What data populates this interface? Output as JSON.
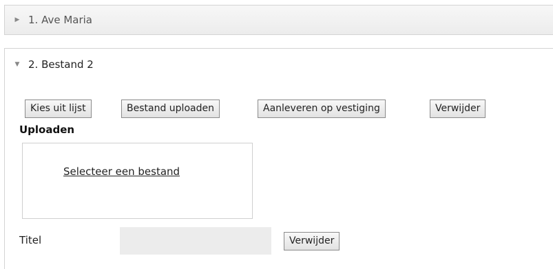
{
  "accordion": {
    "item1": {
      "label": "1. Ave Maria",
      "state": "collapsed"
    },
    "item2": {
      "label": "2. Bestand 2",
      "state": "expanded"
    }
  },
  "toolbar": {
    "choose_from_list": "Kies uit lijst",
    "upload_file": "Bestand uploaden",
    "deliver_at_branch": "Aanleveren op vestiging",
    "remove": "Verwijder"
  },
  "upload": {
    "heading": "Uploaden",
    "select_file_link": "Selecteer een bestand"
  },
  "title_field": {
    "label": "Titel",
    "value": "",
    "remove": "Verwijder"
  },
  "icons": {
    "collapsed": "caret-right-icon",
    "expanded": "caret-down-icon"
  }
}
